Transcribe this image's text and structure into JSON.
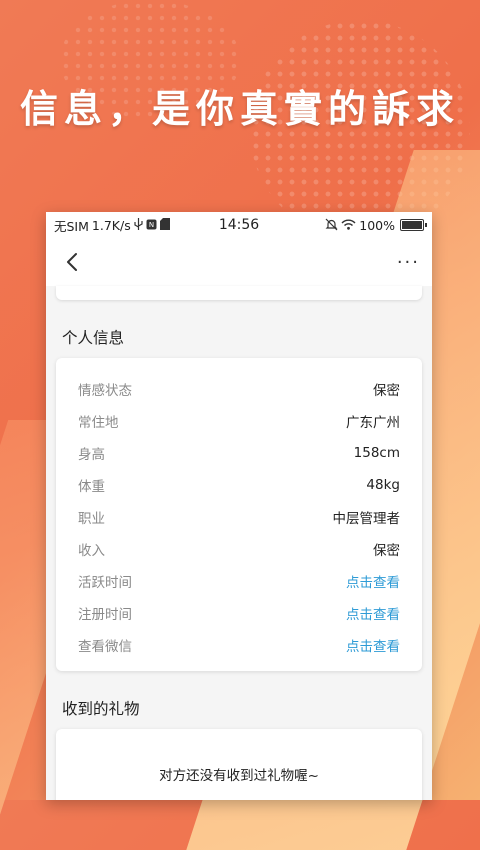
{
  "banner": {
    "headline": "信息，是你真實的訴求"
  },
  "statusbar": {
    "carrier": "无SIM",
    "speed": "1.7K/s",
    "time": "14:56",
    "battery": "100%",
    "icons": [
      "usb-icon",
      "nfc-icon",
      "sim-icon",
      "mute-icon",
      "wifi-icon",
      "battery-icon"
    ]
  },
  "navbar": {
    "back_icon": "chevron-left-icon",
    "more_label": "···"
  },
  "personal_info": {
    "title": "个人信息",
    "rows": [
      {
        "label": "情感状态",
        "value": "保密",
        "link": false
      },
      {
        "label": "常住地",
        "value": "广东广州",
        "link": false
      },
      {
        "label": "身高",
        "value": "158cm",
        "link": false
      },
      {
        "label": "体重",
        "value": "48kg",
        "link": false
      },
      {
        "label": "职业",
        "value": "中层管理者",
        "link": false
      },
      {
        "label": "收入",
        "value": "保密",
        "link": false
      },
      {
        "label": "活跃时间",
        "value": "点击查看",
        "link": true
      },
      {
        "label": "注册时间",
        "value": "点击查看",
        "link": true
      },
      {
        "label": "查看微信",
        "value": "点击查看",
        "link": true
      }
    ]
  },
  "gifts": {
    "title": "收到的礼物",
    "empty_text": "对方还没有收到过礼物喔~"
  },
  "colors": {
    "accent_link": "#2e9bd6",
    "bg_orange": "#ef6f4a"
  }
}
